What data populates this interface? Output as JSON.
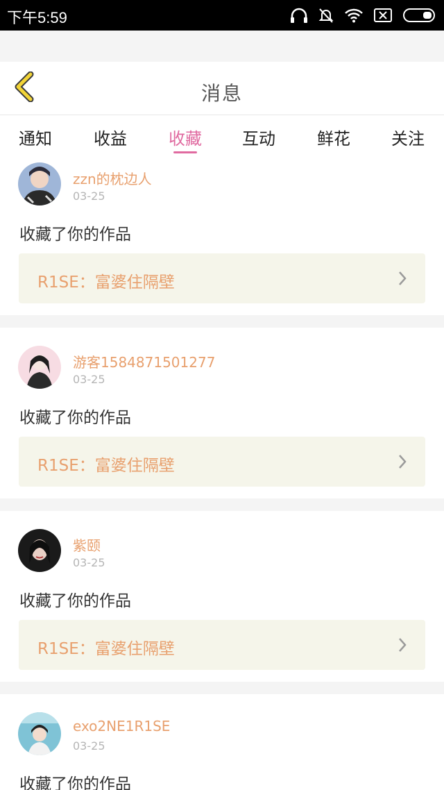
{
  "status_bar": {
    "time": "下午5:59",
    "icons": [
      "headphones-icon",
      "bell-off-icon",
      "wifi-icon",
      "sim-off-icon",
      "battery-icon"
    ]
  },
  "header": {
    "title": "消息",
    "back_icon": "chevron-left-icon"
  },
  "tabs": [
    {
      "label": "通知"
    },
    {
      "label": "收益"
    },
    {
      "label": "收藏",
      "active": true
    },
    {
      "label": "互动"
    },
    {
      "label": "鲜花"
    },
    {
      "label": "关注"
    }
  ],
  "notifications": [
    {
      "username": "zzn的枕边人",
      "date": "03-25",
      "action": "收藏了你的作品",
      "work_title": "R1SE：富婆住隔壁"
    },
    {
      "username": "游客1584871501277",
      "date": "03-25",
      "action": "收藏了你的作品",
      "work_title": "R1SE：富婆住隔壁"
    },
    {
      "username": "紫颐",
      "date": "03-25",
      "action": "收藏了你的作品",
      "work_title": "R1SE：富婆住隔壁"
    },
    {
      "username": "exo2NE1R1SE",
      "date": "03-25",
      "action": "收藏了你的作品"
    }
  ],
  "colors": {
    "accent_pink": "#e06aa0",
    "username_orange": "#e8a06e",
    "back_yellow": "#f2d437",
    "work_box_bg": "#f5f5ea"
  }
}
